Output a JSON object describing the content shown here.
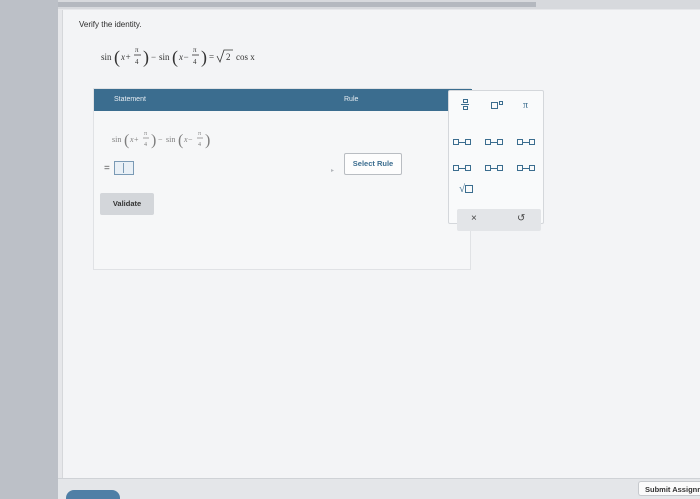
{
  "problem": {
    "prompt": "Verify the identity.",
    "equation": {
      "lhs_a_fn": "sin",
      "lhs_a_arg": "x+",
      "pi": "π",
      "four": "4",
      "minus": "−",
      "lhs_b_fn": "sin",
      "lhs_b_arg": "x−",
      "equals": "=",
      "sqrt_arg": "2",
      "rhs_tail": "cos x"
    }
  },
  "proof_table": {
    "headers": {
      "statement": "Statement",
      "rule": "Rule"
    },
    "statement_row": {
      "fn_a": "sin",
      "arg_a": "x+",
      "pi": "π",
      "four": "4",
      "minus": "−",
      "fn_b": "sin",
      "arg_b": "x−"
    },
    "equals_sign": "=",
    "select_rule_label": "Select Rule",
    "validate_label": "Validate"
  },
  "keypad": {
    "pi_label": "π",
    "clear_label": "×",
    "undo_label": "↺"
  },
  "footer": {
    "submit_label": "Submit Assignment"
  }
}
